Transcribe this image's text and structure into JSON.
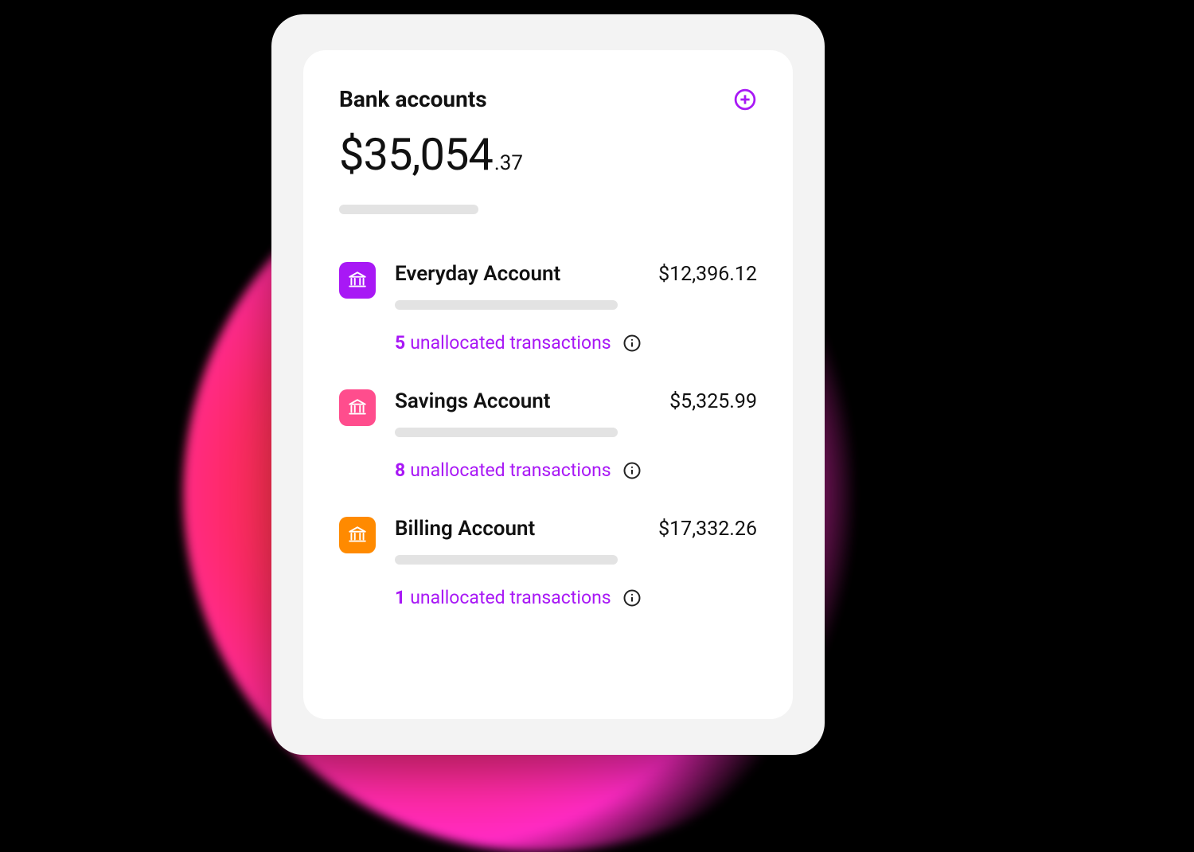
{
  "panel": {
    "title": "Bank accounts",
    "total_main": "$35,054",
    "total_cents": ".37"
  },
  "accounts": [
    {
      "name": "Everyday Account",
      "balance": "$12,396.12",
      "icon_color": "purple",
      "unallocated_count": "5",
      "unallocated_label": "unallocated transactions"
    },
    {
      "name": "Savings Account",
      "balance": "$5,325.99",
      "icon_color": "pink",
      "unallocated_count": "8",
      "unallocated_label": "unallocated transactions"
    },
    {
      "name": "Billing Account",
      "balance": "$17,332.26",
      "icon_color": "orange",
      "unallocated_count": "1",
      "unallocated_label": "unallocated transactions"
    }
  ]
}
